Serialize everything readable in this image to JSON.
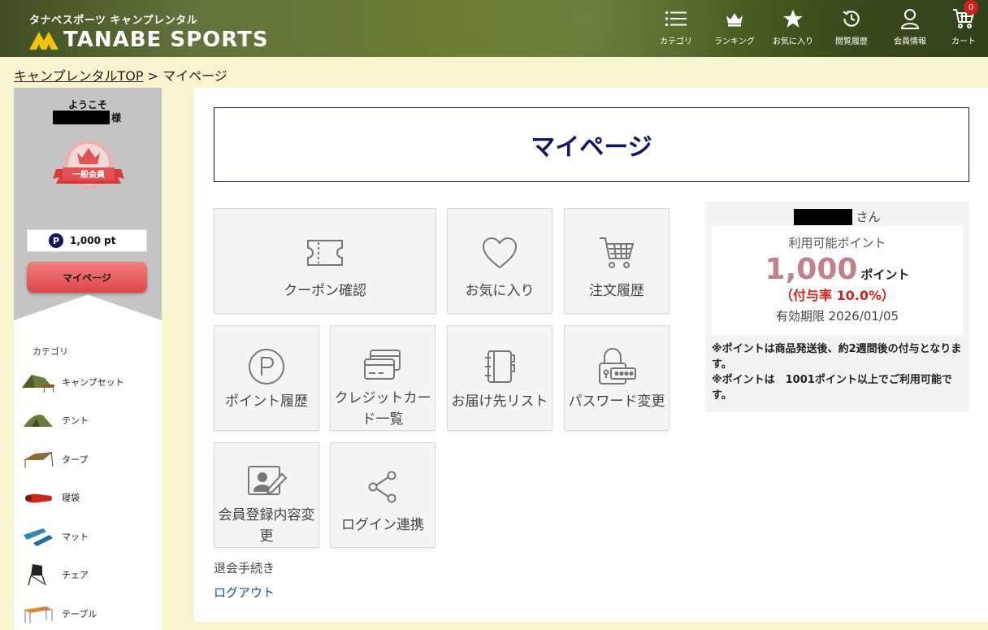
{
  "header": {
    "brand_sub": "タナベスポーツ キャンプレンタル",
    "brand_name": "TANABE SPORTS",
    "nav": {
      "category": "カテゴリ",
      "ranking": "ランキング",
      "favorites": "お気に入り",
      "history": "閲覧履歴",
      "member": "会員情報",
      "cart": "カート",
      "cart_count": "0"
    }
  },
  "breadcrumb": {
    "home": "キャンプレンタルTOP",
    "separator": " > ",
    "current": "マイページ"
  },
  "sidebar": {
    "welcome": "ようこそ",
    "honorific": "様",
    "rank_label": "一般会員",
    "points_icon": "P",
    "points": "1,000 pt",
    "mypage_button": "マイページ",
    "category_title": "カテゴリ",
    "categories": [
      {
        "label": "キャンプセット",
        "icon": "camp-set"
      },
      {
        "label": "テント",
        "icon": "tent"
      },
      {
        "label": "タープ",
        "icon": "tarp"
      },
      {
        "label": "寝袋",
        "icon": "sleeping-bag"
      },
      {
        "label": "マット",
        "icon": "mat"
      },
      {
        "label": "チェア",
        "icon": "chair"
      },
      {
        "label": "テーブル",
        "icon": "table"
      }
    ]
  },
  "main": {
    "title": "マイページ",
    "tiles": {
      "coupon": "クーポン確認",
      "favorites": "お気に入り",
      "orders": "注文履歴",
      "points": "ポイント履歴",
      "cards": "クレジットカード一覧",
      "address": "お届け先リスト",
      "password": "パスワード変更",
      "profile": "会員登録内容変更",
      "login_link": "ログイン連携"
    },
    "quit": "退会手続き",
    "logout": "ログアウト"
  },
  "point_panel": {
    "honorific": "さん",
    "label": "利用可能ポイント",
    "value": "1,000",
    "unit": "ポイント",
    "rate": "（付与率 10.0%）",
    "expiry": "有効期限 2026/01/05",
    "note1": "※ポイントは商品発送後、約2週間後の付与となります。",
    "note2": "※ポイントは　1001ポイント以上でご利用可能です。"
  },
  "colors": {
    "background": "#f8f4cf",
    "navy": "#141468",
    "button_red": "#e04545",
    "point_pink": "#c27f8c",
    "rate_red": "#d82020",
    "link_blue": "#1d4f8a"
  }
}
